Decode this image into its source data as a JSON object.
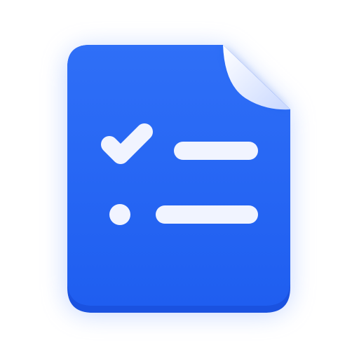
{
  "app_icon": {
    "name": "checklist-document-icon",
    "colors": {
      "background": "#ffffff",
      "page_top": "#2f6ff7",
      "page_bottom": "#1f5ef0",
      "page_edge": "#1a52e0",
      "glow": "#8fb0ff",
      "glyph": "#f1f4ff",
      "fold_light": "#ffffff",
      "fold_shade": "#c9d8ff"
    },
    "rows": [
      {
        "marker": "checkmark-icon",
        "state": "checked"
      },
      {
        "marker": "bullet-dot-icon",
        "state": "unchecked"
      }
    ]
  }
}
